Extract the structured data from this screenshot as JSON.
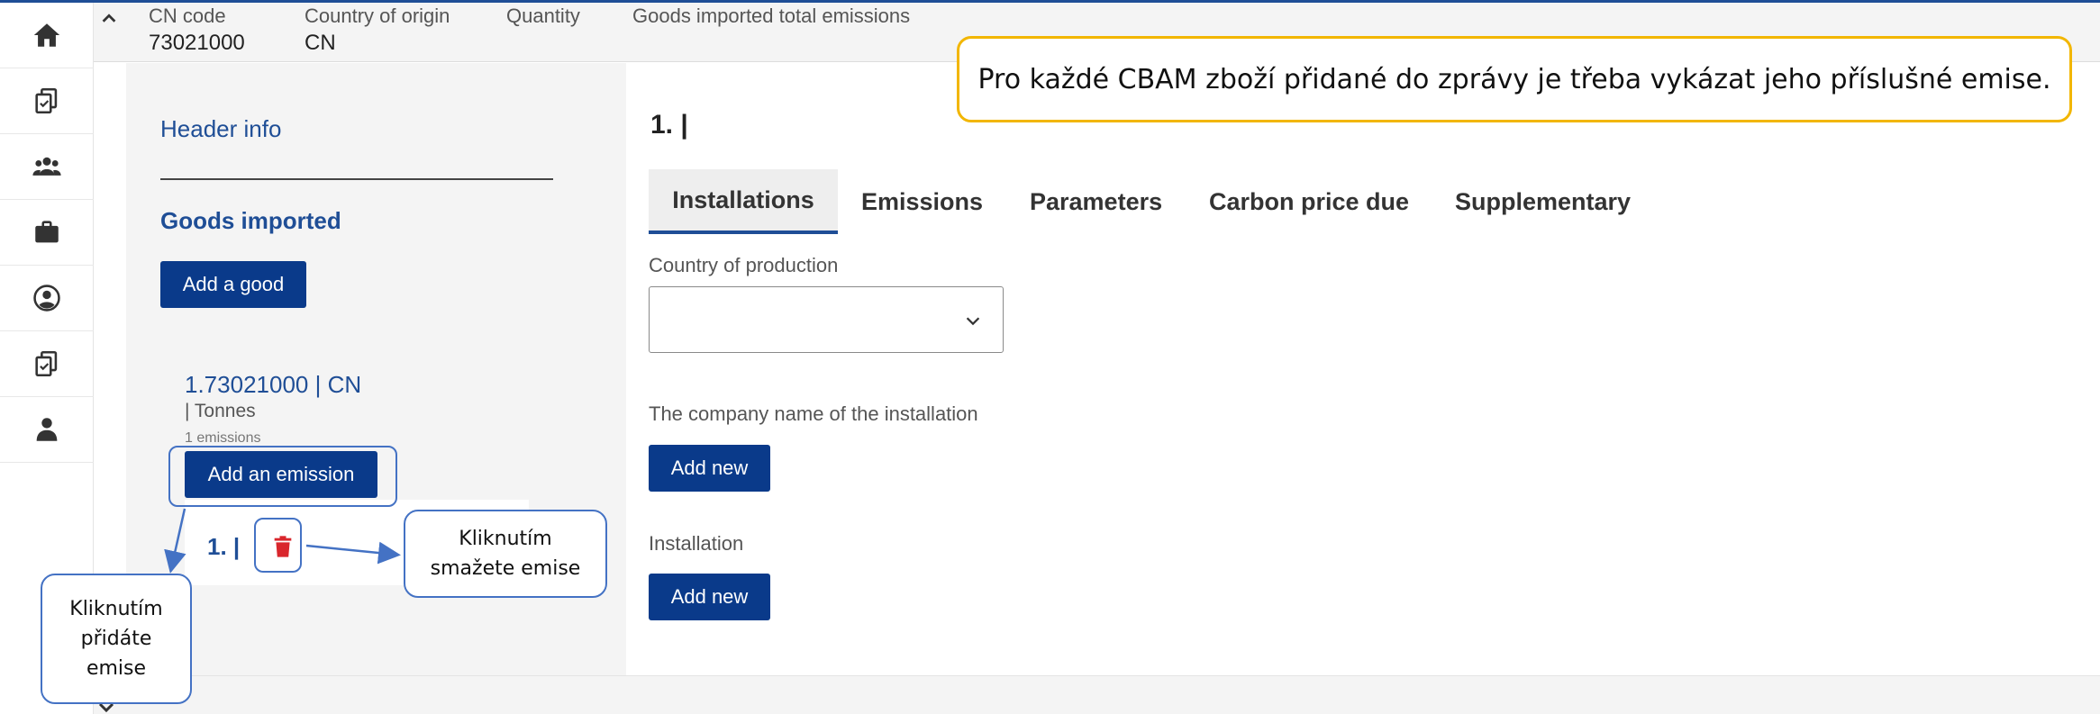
{
  "header": {
    "columns": [
      {
        "label": "CN code",
        "value": "73021000"
      },
      {
        "label": "Country of origin",
        "value": "CN"
      },
      {
        "label": "Quantity",
        "value": ""
      },
      {
        "label": "Goods imported total emissions",
        "value": ""
      }
    ]
  },
  "left_panel": {
    "header_info_link": "Header info",
    "goods_title": "Goods imported",
    "add_good_label": "Add a good",
    "good": {
      "code_line": "1.73021000 | CN",
      "unit_line": "| Tonnes",
      "count_line": "1 emissions",
      "add_emission_label": "Add an emission",
      "emission_item": "1. |"
    }
  },
  "main": {
    "title": "1. |",
    "tabs": [
      {
        "label": "Installations",
        "active": true
      },
      {
        "label": "Emissions",
        "active": false
      },
      {
        "label": "Parameters",
        "active": false
      },
      {
        "label": "Carbon price due",
        "active": false
      },
      {
        "label": "Supplementary",
        "active": false
      }
    ],
    "country_of_production_label": "Country of production",
    "country_of_production_value": "",
    "company_name_label": "The company name of the installation",
    "company_add_new": "Add new",
    "installation_label": "Installation",
    "installation_add_new": "Add new"
  },
  "annotations": {
    "top_note": "Pro každé CBAM zboží přidané do zprávy je třeba vykázat jeho příslušné emise.",
    "delete_note": [
      "Kliknutím",
      "smažete emise"
    ],
    "add_note": [
      "Kliknutím",
      "přidáte",
      "emise"
    ]
  },
  "sidebar_icons": [
    "home-icon",
    "documents-icon",
    "users-icon",
    "briefcase-icon",
    "account-circle-icon",
    "documents-icon",
    "person-icon"
  ],
  "colors": {
    "primary": "#0a3a8a",
    "link": "#1f4e96",
    "delete": "#d9262c",
    "highlight": "#f2b600",
    "callout": "#4472c4"
  }
}
